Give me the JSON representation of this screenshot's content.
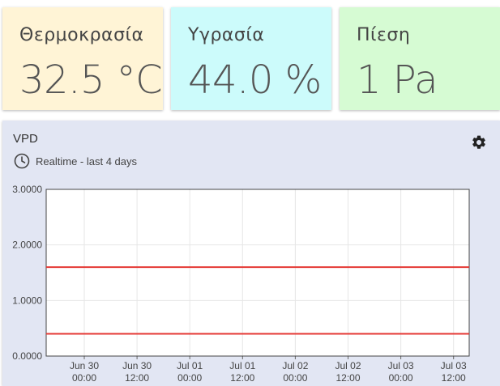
{
  "cards": {
    "temperature": {
      "title": "Θερμοκρασία",
      "value": "32.5 °C"
    },
    "humidity": {
      "title": "Υγρασία",
      "value": "44.0 %"
    },
    "pressure": {
      "title": "Πίεση",
      "value": "1 Pa"
    }
  },
  "panel": {
    "title": "VPD",
    "subtitle": "Realtime - last 4 days",
    "clock_icon": "clock-icon",
    "settings_icon": "gear-icon"
  },
  "colors": {
    "temperature_card": "#fff4d6",
    "humidity_card": "#ccfbfb",
    "pressure_card": "#d6fbd3",
    "panel_bg": "#e2e6f3",
    "series_line": "#e53935"
  },
  "chart_data": {
    "type": "line",
    "title": "",
    "xlabel": "",
    "ylabel": "",
    "ylim": [
      0,
      3
    ],
    "y_ticks": [
      "0.0000",
      "1.0000",
      "2.0000",
      "3.0000"
    ],
    "x_ticks": [
      [
        "Jun 30",
        "00:00"
      ],
      [
        "Jun 30",
        "12:00"
      ],
      [
        "Jul 01",
        "00:00"
      ],
      [
        "Jul 01",
        "12:00"
      ],
      [
        "Jul 02",
        "00:00"
      ],
      [
        "Jul 02",
        "12:00"
      ],
      [
        "Jul 03",
        "00:00"
      ],
      [
        "Jul 03",
        "12:00"
      ]
    ],
    "grid": true,
    "series": [
      {
        "values": [
          1.6,
          1.6
        ]
      },
      {
        "values": [
          0.4,
          0.4
        ]
      }
    ]
  }
}
